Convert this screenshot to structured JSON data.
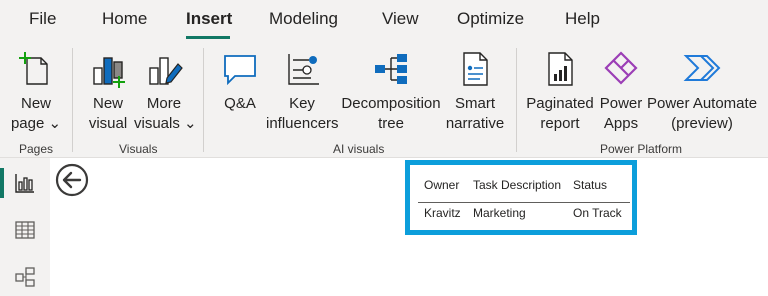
{
  "menu": {
    "items": [
      "File",
      "Home",
      "Insert",
      "Modeling",
      "View",
      "Optimize",
      "Help"
    ],
    "active": "Insert"
  },
  "ribbon": {
    "pages_group": {
      "label": "Pages",
      "new_page": {
        "line1": "New",
        "line2": "page ⌄"
      }
    },
    "visuals_group": {
      "label": "Visuals",
      "new_visual": {
        "line1": "New",
        "line2": "visual"
      },
      "more_visuals": {
        "line1": "More",
        "line2": "visuals ⌄"
      }
    },
    "ai_group": {
      "label": "AI visuals",
      "qna": {
        "line1": "Q&A",
        "line2": ""
      },
      "key_influencers": {
        "line1": "Key",
        "line2": "influencers"
      },
      "decomposition_tree": {
        "line1": "Decomposition",
        "line2": "tree"
      },
      "smart_narrative": {
        "line1": "Smart",
        "line2": "narrative"
      }
    },
    "power_group": {
      "label": "Power Platform",
      "paginated_report": {
        "line1": "Paginated",
        "line2": "report"
      },
      "power_apps": {
        "line1": "Power",
        "line2": "Apps"
      },
      "power_automate": {
        "line1": "Power Automate",
        "line2": "(preview)"
      }
    }
  },
  "rail": {
    "icons": [
      "report-view-icon",
      "table-view-icon",
      "model-view-icon"
    ],
    "active": "report-view-icon"
  },
  "table_visual": {
    "columns": [
      "Owner",
      "Task Description",
      "Status"
    ],
    "rows": [
      [
        "Kravitz",
        "Marketing",
        "On Track"
      ]
    ]
  },
  "colors": {
    "accent": "#117865",
    "selection_border": "#0c9edb",
    "power_apps": "#9b3eb6",
    "power_automate": "#1f7ad9",
    "icon_blue": "#0f6cbd",
    "icon_green": "#13a10e"
  }
}
